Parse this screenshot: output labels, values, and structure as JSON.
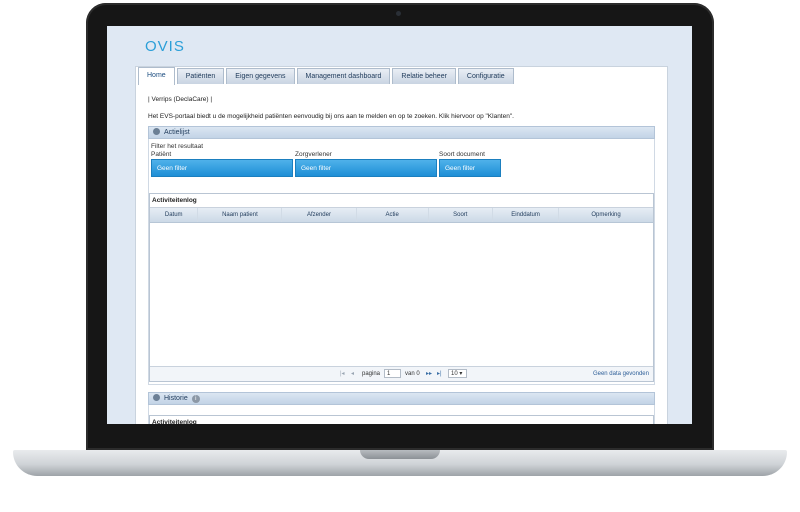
{
  "app": {
    "brand": "OVIS"
  },
  "tabs": [
    {
      "label": "Home",
      "active": true
    },
    {
      "label": "Patiënten",
      "active": false
    },
    {
      "label": "Eigen gegevens",
      "active": false
    },
    {
      "label": "Management dashboard",
      "active": false
    },
    {
      "label": "Relatie beheer",
      "active": false
    },
    {
      "label": "Configuratie",
      "active": false
    }
  ],
  "breadcrumb": "| Verrips (DeclaCare) |",
  "intro_text": "Het EVS-portaal biedt u de mogelijkheid patiënten eenvoudig bij ons aan te melden en op te zoeken. Klik hiervoor op \"Klanten\".",
  "actielijst": {
    "title": "Actielijst",
    "filter_title": "Filter het resultaat",
    "filters": [
      {
        "label": "Patiënt",
        "value": "Geen filter"
      },
      {
        "label": "Zorgverlener",
        "value": "Geen filter"
      },
      {
        "label": "Soort document",
        "value": "Geen filter"
      }
    ],
    "grid": {
      "caption": "Activiteitenlog",
      "columns": [
        "Datum",
        "Naam patient",
        "Afzender",
        "Actie",
        "Soort",
        "Einddatum",
        "Opmerking"
      ]
    },
    "pager": {
      "page_label": "pagina",
      "page_value": "1",
      "of_label": "van 0",
      "page_size": "10",
      "status": "Geen data gevonden"
    }
  },
  "historie": {
    "title": "Historie",
    "grid_caption": "Activiteitenlog"
  },
  "colors": {
    "accent": "#2b9fd8",
    "button": "#1e8fd6",
    "bezel": "#161616"
  }
}
